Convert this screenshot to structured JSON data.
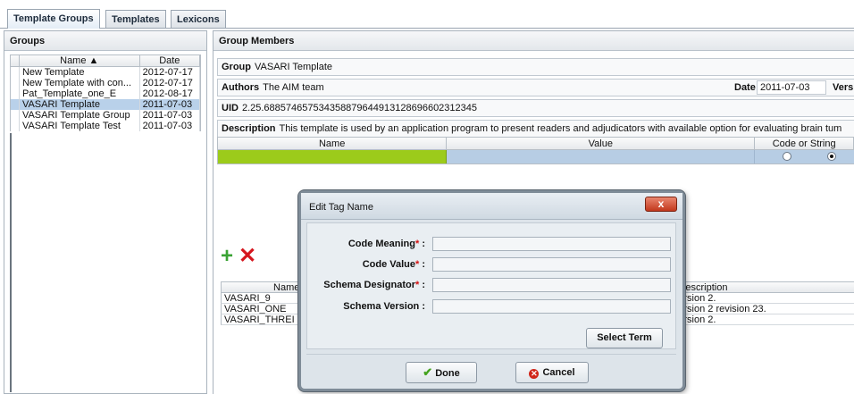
{
  "tabs": [
    {
      "label": "Template Groups"
    },
    {
      "label": "Templates"
    },
    {
      "label": "Lexicons"
    }
  ],
  "groups_panel": {
    "title": "Groups",
    "columns": [
      "Name ▲",
      "Date"
    ],
    "rows": [
      {
        "name": "New Template",
        "date": "2012-07-17"
      },
      {
        "name": "New Template with con...",
        "date": "2012-07-17"
      },
      {
        "name": "Pat_Template_one_E",
        "date": "2012-08-17"
      },
      {
        "name": "VASARI Template",
        "date": "2011-07-03"
      },
      {
        "name": "VASARI Template Group",
        "date": "2011-07-03"
      },
      {
        "name": "VASARI Template Test",
        "date": "2011-07-03"
      }
    ],
    "selected_row": "VASARI Template"
  },
  "members_panel": {
    "title": "Group Members",
    "group_label": "Group",
    "group_value": "VASARI Template",
    "authors_label": "Authors",
    "authors_value": "The AIM team",
    "date_label": "Date",
    "date_value": "2011-07-03",
    "version_label": "Versio",
    "uid_label": "UID",
    "uid_value": "2.25.68857465753435887964491312869660231234​5",
    "description_label": "Description",
    "description_value": "This template is used by an application program to present readers and adjudicators with available option for evaluating brain tum",
    "table_columns": {
      "name": "Name",
      "value": "Value",
      "code": "Code or String"
    }
  },
  "lexicon_table": {
    "columns": {
      "name": "Name",
      "description": "escription"
    },
    "rows": [
      {
        "name": "VASARI_9",
        "description": "rsion 2."
      },
      {
        "name": "VASARI_ONE",
        "description": "rsion 2 revision 23."
      },
      {
        "name": "VASARI_THREI",
        "description": "rsion 2."
      }
    ]
  },
  "dialog": {
    "title": "Edit Tag Name",
    "close_glyph": "x",
    "fields": [
      {
        "label": "Code Meaning",
        "required": true,
        "value": ""
      },
      {
        "label": "Code Value",
        "required": true,
        "value": ""
      },
      {
        "label": "Schema Designator",
        "required": true,
        "value": ""
      },
      {
        "label": "Schema Version",
        "required": false,
        "value": ""
      }
    ],
    "required_mark": "*",
    "colon": " :",
    "select_term_label": "Select Term",
    "done_label": "Done",
    "cancel_label": "Cancel"
  },
  "icons": {
    "add": "plus-icon",
    "remove": "delete-x-icon",
    "done": "checkmark-icon",
    "cancel": "cancel-icon"
  },
  "colors": {
    "selected_row": "#b9d1ea",
    "name_cell": "#9ccb1b",
    "value_cell": "#b7cde4",
    "add_icon": "#3aa334",
    "remove_icon": "#d5161e",
    "required_mark": "#d41111",
    "dialog_close": "#c2381c"
  }
}
